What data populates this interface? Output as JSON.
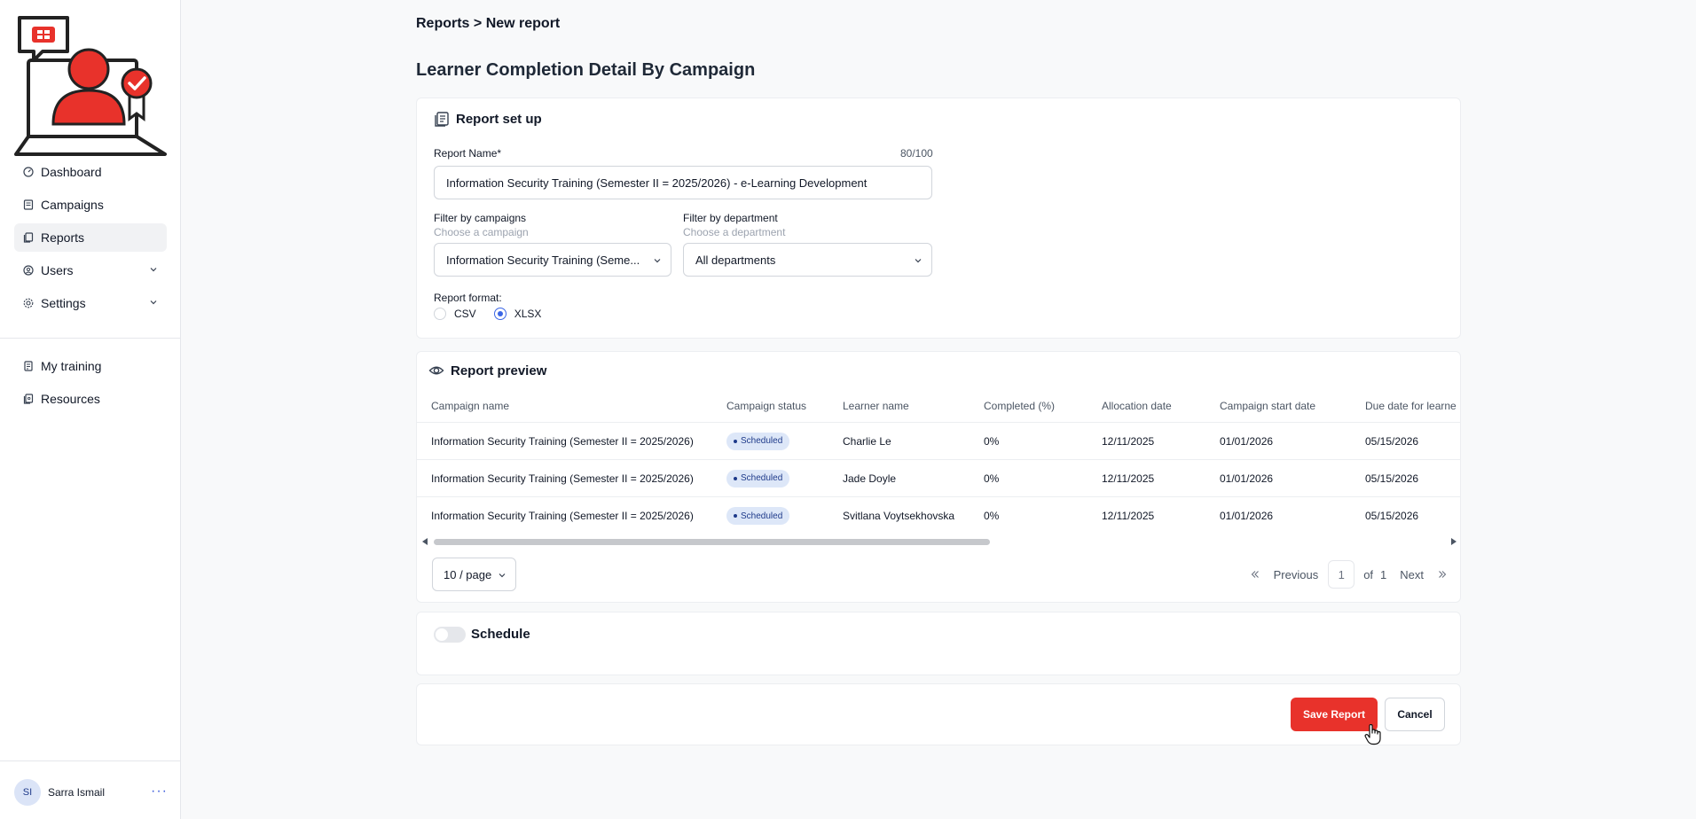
{
  "sidebar": {
    "items": [
      {
        "label": "Dashboard",
        "icon": "dashboard-icon"
      },
      {
        "label": "Campaigns",
        "icon": "campaigns-icon"
      },
      {
        "label": "Reports",
        "icon": "reports-icon",
        "active": true
      },
      {
        "label": "Users",
        "icon": "users-icon",
        "expandable": true
      },
      {
        "label": "Settings",
        "icon": "settings-icon",
        "expandable": true
      }
    ],
    "secondary_items": [
      {
        "label": "My training",
        "icon": "training-icon"
      },
      {
        "label": "Resources",
        "icon": "resources-icon"
      }
    ],
    "user": {
      "initials": "SI",
      "name": "Sarra Ismail",
      "more": "···"
    }
  },
  "breadcrumb": "Reports > New report",
  "page_title": "Learner Completion Detail By Campaign",
  "setup": {
    "title": "Report set up",
    "name_label": "Report Name*",
    "name_counter": "80/100",
    "name_value": "Information Security Training (Semester II = 2025/2026) - e-Learning Development",
    "campaign_filter": {
      "label": "Filter by campaigns",
      "hint": "Choose a campaign",
      "value": "Information Security Training (Seme..."
    },
    "department_filter": {
      "label": "Filter by department",
      "hint": "Choose a department",
      "value": "All departments"
    },
    "format_label": "Report format:",
    "formats": [
      {
        "label": "CSV",
        "selected": false
      },
      {
        "label": "XLSX",
        "selected": true
      }
    ]
  },
  "preview": {
    "title": "Report preview",
    "columns": [
      "Campaign name",
      "Campaign status",
      "Learner name",
      "Completed (%)",
      "Allocation date",
      "Campaign start date",
      "Due date for learne"
    ],
    "rows": [
      [
        "Information Security Training (Semester II = 2025/2026)",
        "Scheduled",
        "Charlie Le",
        "0%",
        "12/11/2025",
        "01/01/2026",
        "05/15/2026"
      ],
      [
        "Information Security Training (Semester II = 2025/2026)",
        "Scheduled",
        "Jade Doyle",
        "0%",
        "12/11/2025",
        "01/01/2026",
        "05/15/2026"
      ],
      [
        "Information Security Training (Semester II = 2025/2026)",
        "Scheduled",
        "Svitlana Voytsekhovska",
        "0%",
        "12/11/2025",
        "01/01/2026",
        "05/15/2026"
      ]
    ],
    "page_size": "10 / page",
    "pagination": {
      "previous": "Previous",
      "current": "1",
      "of": "of",
      "total": "1",
      "next": "Next"
    }
  },
  "schedule": {
    "title": "Schedule",
    "enabled": false
  },
  "actions": {
    "save": "Save Report",
    "cancel": "Cancel"
  },
  "colors": {
    "brand_red": "#e8322b",
    "accent_blue": "#3b66e5",
    "badge_bg": "#dde7f8"
  }
}
